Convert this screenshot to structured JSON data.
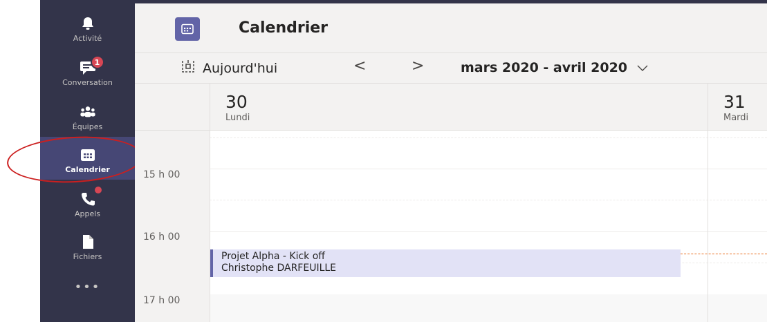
{
  "rail": {
    "items": [
      {
        "label": "Activité",
        "icon": "bell-icon"
      },
      {
        "label": "Conversation",
        "icon": "chat-icon",
        "badge": "1"
      },
      {
        "label": "Équipes",
        "icon": "teams-icon"
      },
      {
        "label": "Calendrier",
        "icon": "calendar-icon",
        "active": true
      },
      {
        "label": "Appels",
        "icon": "phone-icon",
        "dot": true
      },
      {
        "label": "Fichiers",
        "icon": "file-icon"
      }
    ],
    "more": "•••"
  },
  "header": {
    "title": "Calendrier",
    "icon": "calendar-icon"
  },
  "toolbar": {
    "today_label": "Aujourd'hui",
    "prev_glyph": "<",
    "next_glyph": ">",
    "range_label": "mars 2020 - avril 2020"
  },
  "days": [
    {
      "number": "30",
      "name": "Lundi"
    },
    {
      "number": "31",
      "name": "Mardi"
    }
  ],
  "times": [
    "15 h 00",
    "16 h 00",
    "17 h 00"
  ],
  "event": {
    "title": "Projet Alpha - Kick off",
    "organizer": "Christophe DARFEUILLE"
  },
  "colors": {
    "rail": "#33344a",
    "rail_active": "#464775",
    "brand": "#6264a7",
    "badge": "#d74654",
    "event_bg": "#e2e2f6",
    "now_line": "#e96b1b",
    "annotation": "#cc1f1f"
  }
}
